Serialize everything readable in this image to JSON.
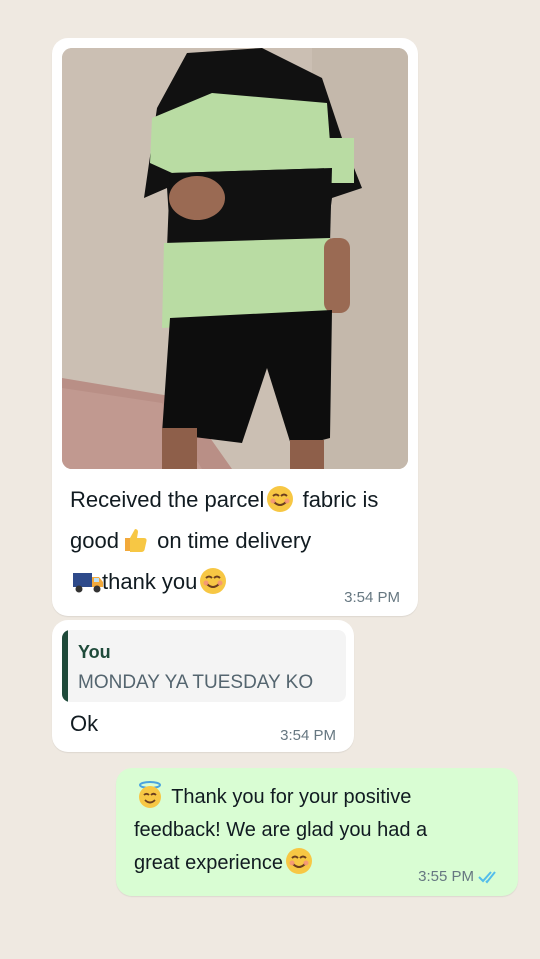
{
  "messages": [
    {
      "direction": "incoming",
      "has_image": true,
      "text_parts": [
        "Received the parcel",
        "fabric is good",
        "on time delivery",
        "thank you"
      ],
      "emoji": [
        "smiling-blush-icon",
        "thumbs-up-icon",
        "truck-icon",
        "smiling-blush-icon"
      ],
      "time": "3:54 PM"
    },
    {
      "direction": "incoming",
      "quote": {
        "author": "You",
        "text": "MONDAY YA TUESDAY KO"
      },
      "text": "Ok",
      "time": "3:54 PM"
    },
    {
      "direction": "outgoing",
      "text_parts": [
        "Thank you for your positive feedback! We are glad you had a great experience"
      ],
      "emoji": [
        "halo-face-icon",
        "smiling-blush-icon"
      ],
      "time": "3:55 PM",
      "status": "read"
    }
  ],
  "colors": {
    "background": "#efe9e1",
    "incoming_bubble": "#ffffff",
    "outgoing_bubble": "#d9fdd3",
    "quote_accent": "#1f4a3a",
    "read_ticks": "#53bdeb"
  }
}
